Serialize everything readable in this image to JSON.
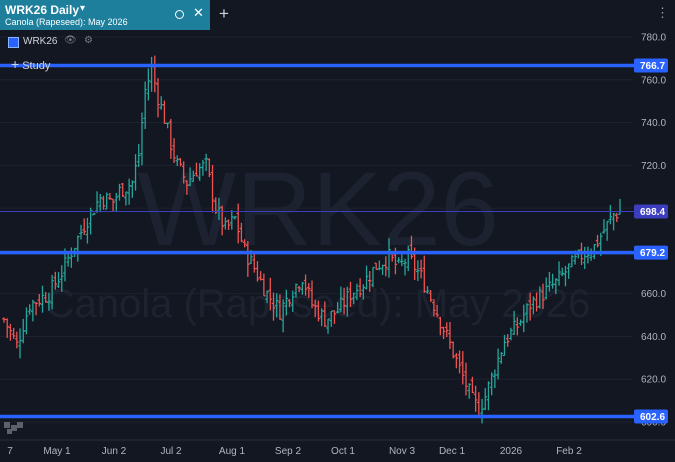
{
  "tab": {
    "title": "WRK26 Daily",
    "caret": "▾",
    "subtitle": "Canola (Rapeseed): May 2026",
    "close": "✕",
    "add": "+"
  },
  "menu": {
    "more": "⋮"
  },
  "legend": {
    "symbol": "WRK26",
    "color": "#2962ff"
  },
  "study": {
    "label": "Study",
    "plus": "+"
  },
  "watermark": {
    "symbol": "WRK26",
    "name": "Canola (Rapeseed): May 2026"
  },
  "colors": {
    "up": "#26a69a",
    "down": "#ef5350",
    "level_line": "#2962ff",
    "last_price_line": "#3d3dbf",
    "background": "#131722"
  },
  "icons": {
    "visibility": "eye-icon",
    "settings": "gear-icon",
    "close": "close-icon",
    "more": "more-vert-icon",
    "add": "plus-icon",
    "tv_logo": "tradingview-logo-icon"
  },
  "chart_data": {
    "type": "ohlc",
    "symbol": "WRK26",
    "interval": "Daily",
    "ylim": [
      598,
      784
    ],
    "y_ticks": [
      600,
      620,
      640,
      660,
      680,
      700,
      720,
      740,
      760,
      780
    ],
    "y_tick_labels": [
      "600.0",
      "620.0",
      "640.0",
      "660.0",
      "680.0",
      "700.0",
      "720.0",
      "740.0",
      "760.0",
      "780.0"
    ],
    "x_ticks": [
      "7",
      "May 1",
      "Jun 2",
      "Jul 2",
      "Aug 1",
      "Sep 2",
      "Oct 1",
      "Nov 3",
      "Dec 1",
      "2026",
      "Feb 2"
    ],
    "horizontal_levels": [
      {
        "value": 766.7,
        "label": "766.7"
      },
      {
        "value": 679.2,
        "label": "679.2"
      },
      {
        "value": 602.6,
        "label": "602.6"
      }
    ],
    "last_price": {
      "value": 698.4,
      "label": "698.4"
    },
    "price_path_approx": [
      [
        0,
        648
      ],
      [
        4,
        636
      ],
      [
        8,
        655
      ],
      [
        14,
        660
      ],
      [
        18,
        670
      ],
      [
        22,
        683
      ],
      [
        26,
        695
      ],
      [
        30,
        705
      ],
      [
        34,
        703
      ],
      [
        36,
        708
      ],
      [
        40,
        712
      ],
      [
        42,
        725
      ],
      [
        44,
        755
      ],
      [
        46,
        765
      ],
      [
        48,
        752
      ],
      [
        50,
        742
      ],
      [
        52,
        730
      ],
      [
        54,
        720
      ],
      [
        57,
        712
      ],
      [
        60,
        718
      ],
      [
        63,
        720
      ],
      [
        66,
        700
      ],
      [
        69,
        690
      ],
      [
        72,
        695
      ],
      [
        75,
        680
      ],
      [
        78,
        672
      ],
      [
        82,
        660
      ],
      [
        86,
        652
      ],
      [
        90,
        662
      ],
      [
        93,
        668
      ],
      [
        96,
        655
      ],
      [
        100,
        648
      ],
      [
        104,
        652
      ],
      [
        108,
        660
      ],
      [
        112,
        665
      ],
      [
        116,
        673
      ],
      [
        120,
        677
      ],
      [
        123,
        672
      ],
      [
        126,
        677
      ],
      [
        130,
        668
      ],
      [
        134,
        655
      ],
      [
        138,
        640
      ],
      [
        142,
        625
      ],
      [
        146,
        610
      ],
      [
        148,
        606
      ],
      [
        150,
        612
      ],
      [
        153,
        625
      ],
      [
        156,
        638
      ],
      [
        160,
        645
      ],
      [
        164,
        655
      ],
      [
        168,
        660
      ],
      [
        172,
        665
      ],
      [
        176,
        672
      ],
      [
        180,
        678
      ],
      [
        184,
        682
      ],
      [
        188,
        692
      ],
      [
        190,
        697
      ],
      [
        192,
        698.4
      ]
    ]
  }
}
